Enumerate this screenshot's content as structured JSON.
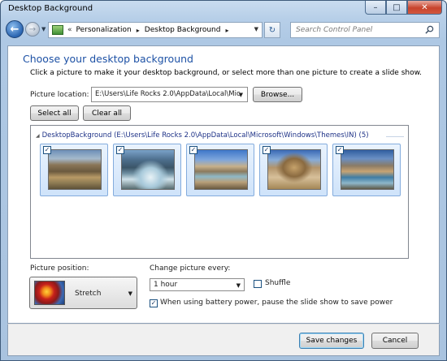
{
  "window": {
    "title": "Desktop Background",
    "minimize_glyph": "–",
    "maximize_glyph": "□",
    "close_glyph": "✕"
  },
  "nav": {
    "back_glyph": "←",
    "forward_glyph": "→",
    "history_glyph": "▼",
    "breadcrumb_sep": "«",
    "crumbs": [
      "Personalization",
      "Desktop Background"
    ],
    "crumb_arrow": "▸",
    "refresh_glyph": "↻",
    "search_placeholder": "Search Control Panel"
  },
  "main": {
    "heading": "Choose your desktop background",
    "instructions": "Click a picture to make it your desktop background, or select more than one picture to create a slide show.",
    "picture_location_label": "Picture location:",
    "picture_location_value": "E:\\Users\\Life Rocks 2.0\\AppData\\Local\\Mic",
    "browse_label": "Browse...",
    "select_all_label": "Select all",
    "clear_all_label": "Clear all"
  },
  "gallery": {
    "group_label": "DesktopBackground (E:\\Users\\Life Rocks 2.0\\AppData\\Local\\Microsoft\\Windows\\Themes\\IN)",
    "group_count": "(5)",
    "items": [
      {
        "checked": true,
        "image": "mountain-valley-yaks"
      },
      {
        "checked": true,
        "image": "mountain-stream-rocks"
      },
      {
        "checked": true,
        "image": "river-valley-snow-peaks"
      },
      {
        "checked": true,
        "image": "stone-house-desert"
      },
      {
        "checked": true,
        "image": "lake-shore-mountains"
      }
    ]
  },
  "options": {
    "position_label": "Picture position:",
    "position_value": "Stretch",
    "change_label": "Change picture every:",
    "interval_value": "1 hour",
    "shuffle_label": "Shuffle",
    "shuffle_checked": false,
    "battery_label": "When using battery power, pause the slide show to save power",
    "battery_checked": true
  },
  "footer": {
    "save_label": "Save changes",
    "cancel_label": "Cancel"
  },
  "colors": {
    "heading": "#1d51a5",
    "group_label": "#1e3287",
    "thumb_border": "#84acdd"
  }
}
